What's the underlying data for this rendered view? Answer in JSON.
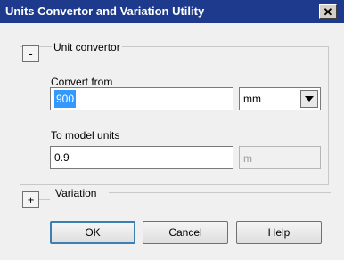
{
  "window": {
    "title": "Units Convertor and Variation Utility",
    "close_glyph": "✕"
  },
  "unit_convertor": {
    "toggle": "-",
    "legend": "Unit convertor",
    "convert_from_label": "Convert from",
    "convert_from_value": "900",
    "from_unit": "mm",
    "to_model_label": "To model units",
    "to_model_value": "0.9",
    "model_unit": "m"
  },
  "variation": {
    "toggle": "+",
    "legend": "Variation"
  },
  "buttons": {
    "ok": "OK",
    "cancel": "Cancel",
    "help": "Help"
  },
  "colors": {
    "titlebar": "#1d3a8c",
    "selection": "#3399ff",
    "default_button_border": "#3c7fb1"
  }
}
